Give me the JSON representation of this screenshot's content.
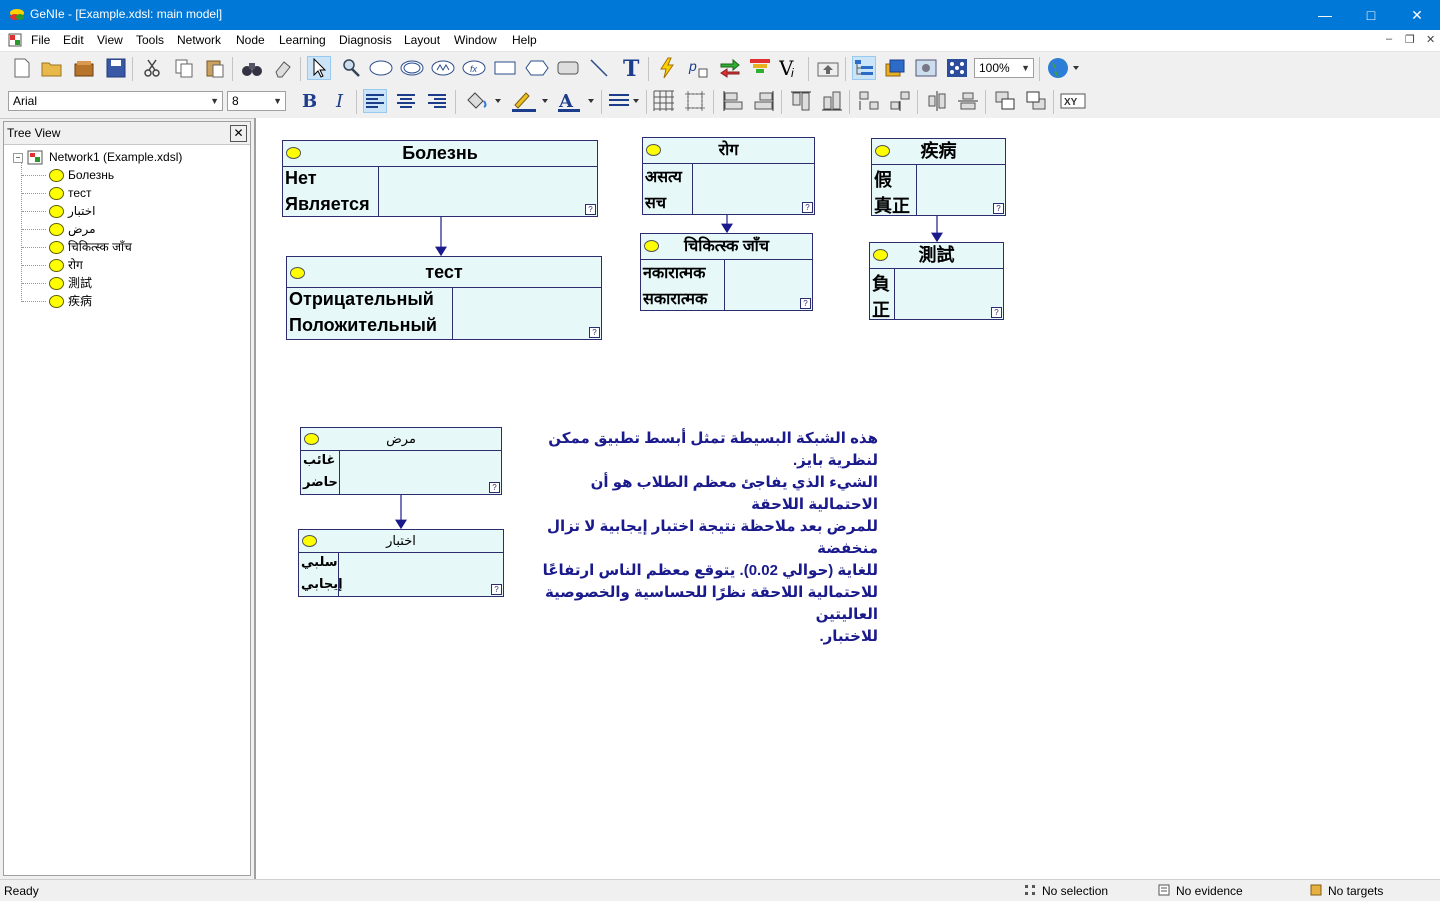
{
  "window": {
    "title": "GeNIe - [Example.xdsl: main model]"
  },
  "menu": [
    "File",
    "Edit",
    "View",
    "Tools",
    "Network",
    "Node",
    "Learning",
    "Diagnosis",
    "Layout",
    "Window",
    "Help"
  ],
  "toolbar": {
    "zoom": "100%",
    "font": "Arial",
    "font_size": "8"
  },
  "tree": {
    "title": "Tree View",
    "close": "✕",
    "root": "Network1 (Example.xdsl)",
    "items": [
      "Болезнь",
      "тест",
      "اختبار",
      "مرض",
      "चिकित्स्क जाँच",
      "रोग",
      "測試",
      "疾病"
    ]
  },
  "nodes": {
    "ru_disease": {
      "title": "Болезнь",
      "states": [
        "Нет",
        "Является"
      ]
    },
    "ru_test": {
      "title": "тест",
      "states": [
        "Отрицательный",
        "Положительный"
      ]
    },
    "hi_disease": {
      "title": "रोग",
      "states": [
        "असत्य",
        "सच"
      ]
    },
    "hi_test": {
      "title": "चिकित्स्क जाँच",
      "states": [
        "नकारात्मक",
        "सकारात्मक"
      ]
    },
    "zh_disease": {
      "title": "疾病",
      "states": [
        "假",
        "真正"
      ]
    },
    "zh_test": {
      "title": "測試",
      "states": [
        "負",
        "正"
      ]
    },
    "ar_disease": {
      "title": "مرض",
      "states": [
        "غائب",
        "حاضر"
      ]
    },
    "ar_test": {
      "title": "اختبار",
      "states": [
        "سلبي",
        "إيجابي"
      ]
    },
    "q": "?"
  },
  "note": {
    "lines": [
      "هذه الشبكة البسيطة تمثل أبسط تطبيق ممكن لنظرية بايز.",
      "الشيء الذي يفاجئ معظم الطلاب هو أن الاحتمالية اللاحقة",
      "للمرض بعد ملاحظة نتيجة اختبار إيجابية لا تزال منخفضة",
      "للغاية (حوالي 0.02). يتوقع معظم الناس ارتفاعًا",
      "للاحتمالية اللاحقة نظرًا للحساسية والخصوصية العاليتين",
      "للاختبار."
    ]
  },
  "status": {
    "ready": "Ready",
    "selection": "No selection",
    "evidence": "No evidence",
    "targets": "No targets"
  }
}
